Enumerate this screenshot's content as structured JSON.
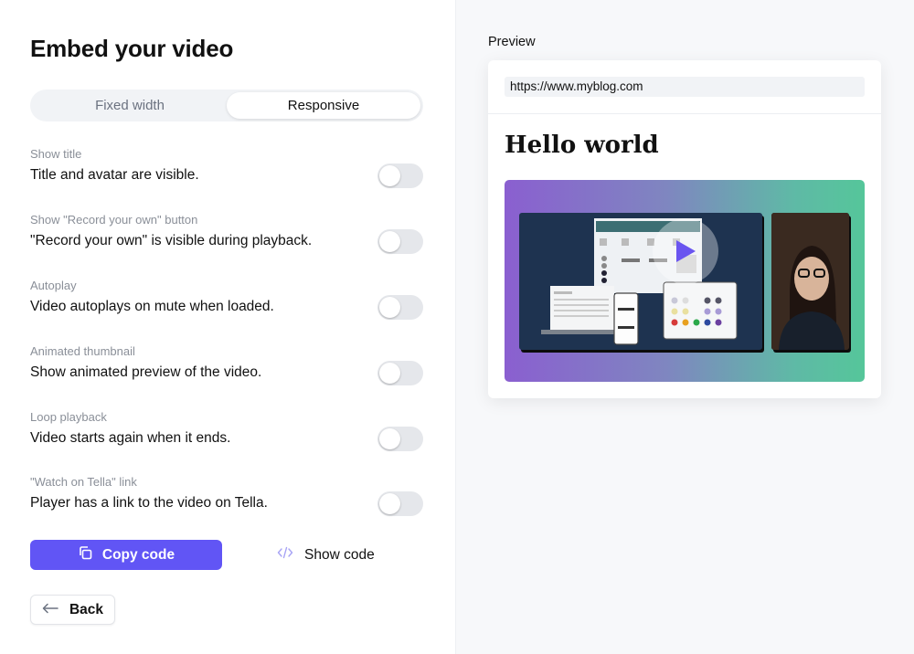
{
  "page": {
    "title": "Embed your video"
  },
  "segment": {
    "options": [
      "Fixed width",
      "Responsive"
    ],
    "selected": "Responsive"
  },
  "options": [
    {
      "label": "Show title",
      "desc": "Title and avatar are visible.",
      "enabled": false
    },
    {
      "label": "Show \"Record your own\" button",
      "desc": "\"Record your own\" is visible during playback.",
      "enabled": false
    },
    {
      "label": "Autoplay",
      "desc": "Video autoplays on mute when loaded.",
      "enabled": false
    },
    {
      "label": "Animated thumbnail",
      "desc": "Show animated preview of the video.",
      "enabled": false
    },
    {
      "label": "Loop playback",
      "desc": "Video starts again when it ends.",
      "enabled": false
    },
    {
      "label": "\"Watch on Tella\" link",
      "desc": "Player has a link to the video on Tella.",
      "enabled": false
    }
  ],
  "actions": {
    "copy_label": "Copy code",
    "copy_icon": "copy-icon",
    "show_label": "Show code",
    "show_icon": "code-icon",
    "back_label": "Back",
    "back_icon": "arrow-left-icon"
  },
  "preview": {
    "label": "Preview",
    "url": "https://www.myblog.com",
    "heading": "Hello world",
    "play_icon": "play-icon"
  },
  "colors": {
    "accent": "#6155f5",
    "toggle_off": "#e5e7eb",
    "panel_bg": "#f7f8fa"
  }
}
